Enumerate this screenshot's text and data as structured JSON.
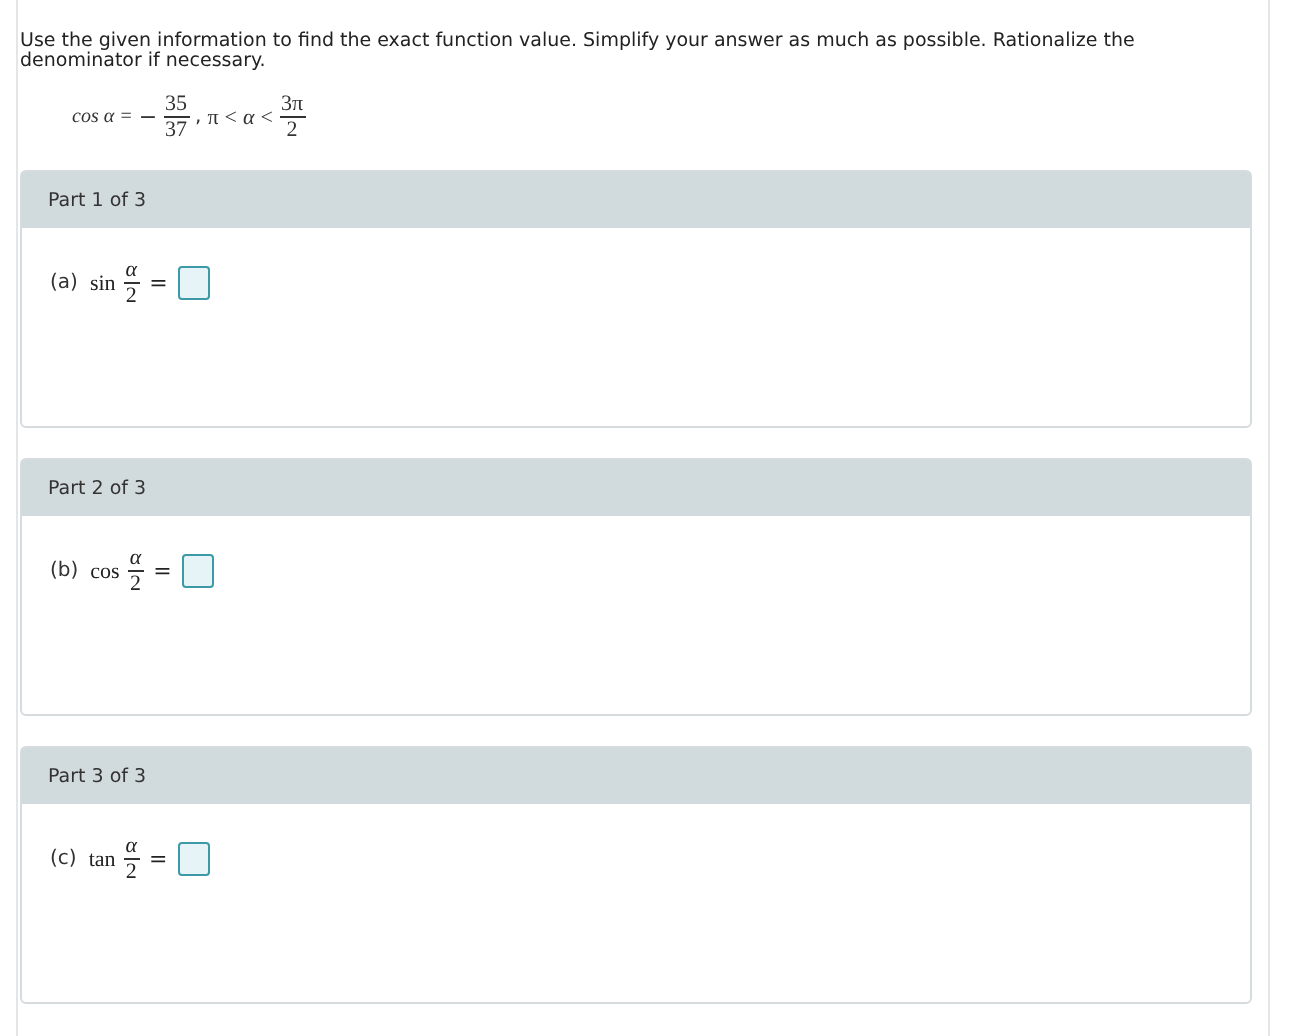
{
  "instructions": "Use the given information to find the exact function value. Simplify your answer as much as possible. Rationalize the denominator if necessary.",
  "given": {
    "lhs": "cos α =",
    "sign": "−",
    "numerator": "35",
    "denominator": "37",
    "separator": ",",
    "lower": "π",
    "less_than_1": "<",
    "variable": "α",
    "less_than_2": "<",
    "upper_numerator": "3π",
    "upper_denominator": "2"
  },
  "parts": [
    {
      "header": "Part 1 of 3",
      "label": "(a)",
      "function": "sin",
      "numerator": "α",
      "denominator": "2",
      "equals": "="
    },
    {
      "header": "Part 2 of 3",
      "label": "(b)",
      "function": "cos",
      "numerator": "α",
      "denominator": "2",
      "equals": "="
    },
    {
      "header": "Part 3 of 3",
      "label": "(c)",
      "function": "tan",
      "numerator": "α",
      "denominator": "2",
      "equals": "="
    }
  ]
}
